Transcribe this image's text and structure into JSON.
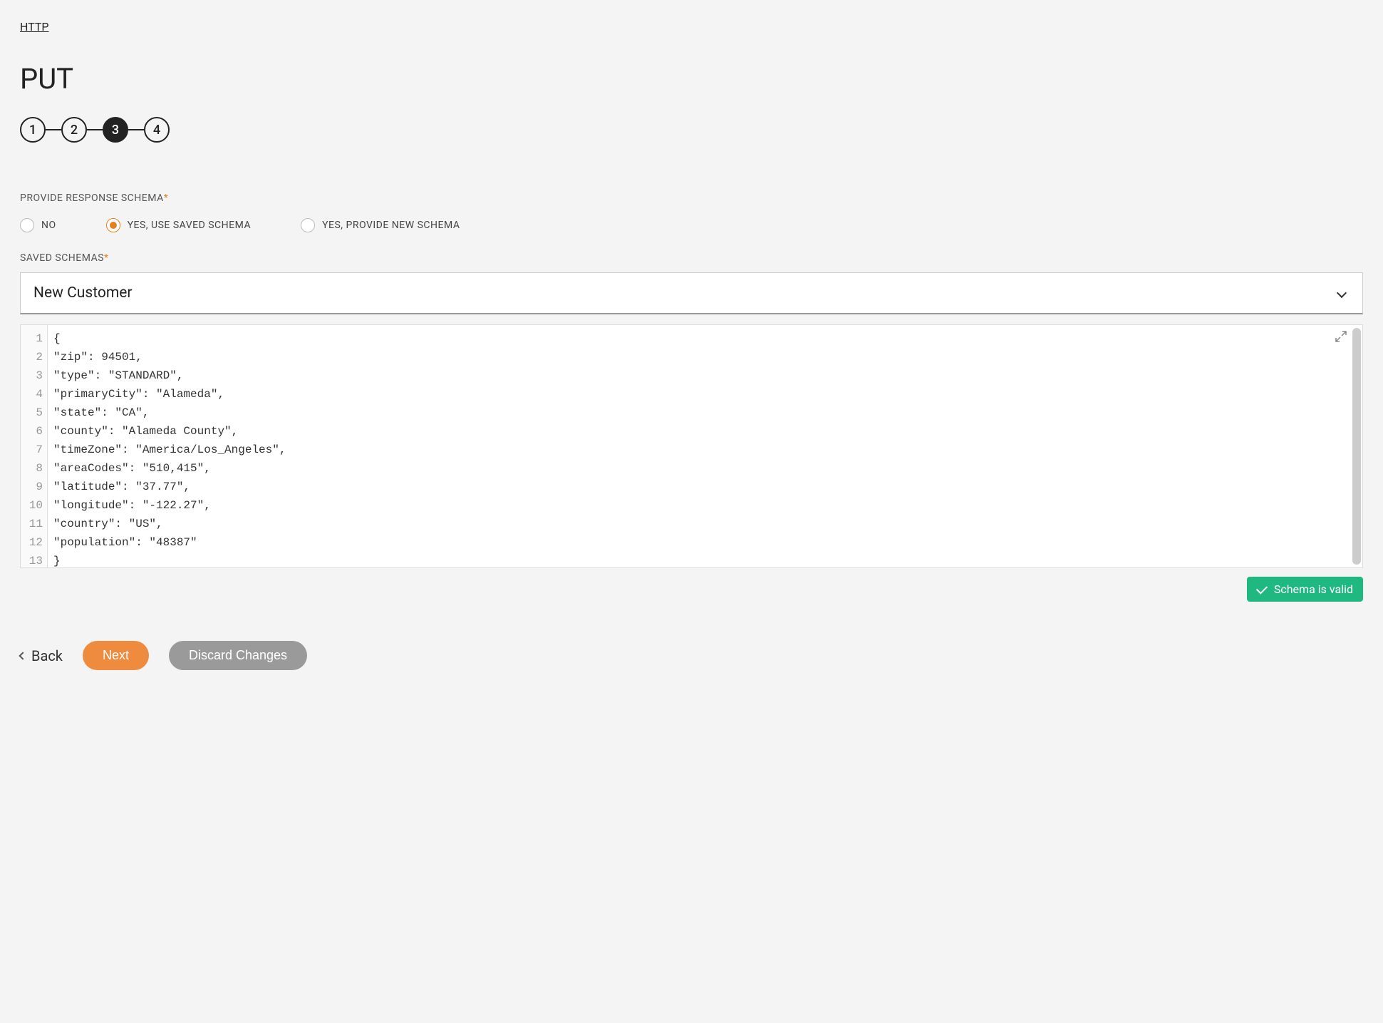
{
  "breadcrumb": "HTTP",
  "title": "PUT",
  "stepper": {
    "steps": [
      "1",
      "2",
      "3",
      "4"
    ],
    "active_index": 2
  },
  "fields": {
    "response_schema_label": "PROVIDE RESPONSE SCHEMA",
    "saved_schemas_label": "SAVED SCHEMAS"
  },
  "radio_options": {
    "no": "NO",
    "use_saved": "YES, USE SAVED SCHEMA",
    "new_schema": "YES, PROVIDE NEW SCHEMA",
    "selected": "use_saved"
  },
  "select": {
    "value": "New Customer"
  },
  "code_lines": [
    "{",
    "\"zip\": 94501,",
    "\"type\": \"STANDARD\",",
    "\"primaryCity\": \"Alameda\",",
    "\"state\": \"CA\",",
    "\"county\": \"Alameda County\",",
    "\"timeZone\": \"America/Los_Angeles\",",
    "\"areaCodes\": \"510,415\",",
    "\"latitude\": \"37.77\",",
    "\"longitude\": \"-122.27\",",
    "\"country\": \"US\",",
    "\"population\": \"48387\"",
    "}"
  ],
  "status": {
    "text": "Schema is valid"
  },
  "buttons": {
    "back": "Back",
    "next": "Next",
    "discard": "Discard Changes"
  }
}
